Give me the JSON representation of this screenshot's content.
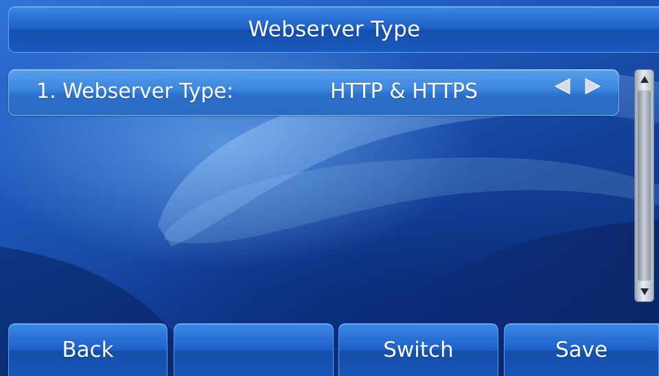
{
  "window": {
    "title": "Webserver Type"
  },
  "settings_list": {
    "items": [
      {
        "label": "1. Webserver Type:",
        "value": "HTTP & HTTPS",
        "selected": true
      }
    ]
  },
  "icons": {
    "left_arrow": "left-arrow-icon",
    "right_arrow": "right-arrow-icon",
    "scroll_up": "scroll-up-icon",
    "scroll_down": "scroll-down-icon"
  },
  "softkeys": {
    "back": "Back",
    "empty": "",
    "switch": "Switch",
    "save": "Save"
  },
  "colors": {
    "background": "#1d56b8",
    "button": "#1d5fc6",
    "selected_item": "#3a84dc",
    "text": "#ffffff"
  }
}
